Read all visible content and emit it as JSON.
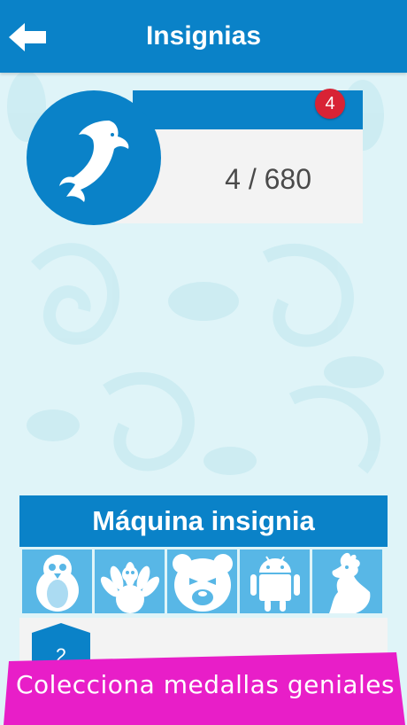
{
  "header": {
    "title": "Insignias",
    "back_icon": "arrow-left-icon",
    "color": "#0a82c8"
  },
  "badge_card": {
    "count": "4 / 680",
    "notification": "4",
    "icon": "dolphin-icon"
  },
  "machine": {
    "title": "Máquina insignia",
    "icons": [
      "penguin-icon",
      "turkey-icon",
      "bear-icon",
      "android-icon",
      "rooster-icon"
    ],
    "counter": "2"
  },
  "promo": {
    "text": "Colecciona medallas geniales",
    "color": "#e81ec8"
  }
}
